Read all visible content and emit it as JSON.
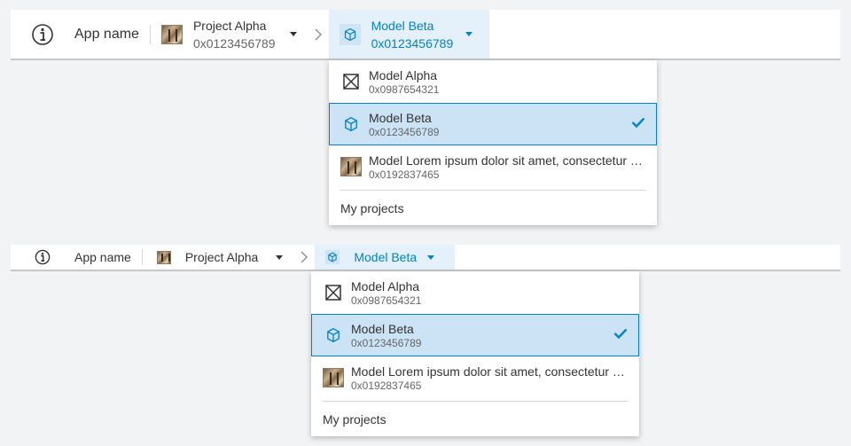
{
  "header": {
    "app_name": "App name",
    "logo_icon": "info-circle-icon",
    "project": {
      "title": "Project Alpha",
      "subtitle": "0x0123456789"
    },
    "model": {
      "title": "Model Beta",
      "subtitle": "0x0123456789"
    }
  },
  "header_compact": {
    "app_name": "App name",
    "project": {
      "title": "Project Alpha"
    },
    "model": {
      "title": "Model Beta"
    }
  },
  "menu": {
    "items": [
      {
        "title": "Model Alpha",
        "subtitle": "0x0987654321",
        "icon": "image-placeholder-icon",
        "selected": false
      },
      {
        "title": "Model Beta",
        "subtitle": "0x0123456789",
        "icon": "cube-icon",
        "selected": true
      },
      {
        "title": "Model Lorem ipsum dolor sit amet, consectetur adipiscing elit",
        "subtitle": "0x0192837465",
        "icon": "thumbnail-image",
        "selected": false
      }
    ],
    "footer": "My projects"
  },
  "colors": {
    "accent": "#0082c8",
    "selected_bg": "#cce3f5",
    "active_crumb_bg": "#e5f1fa"
  }
}
